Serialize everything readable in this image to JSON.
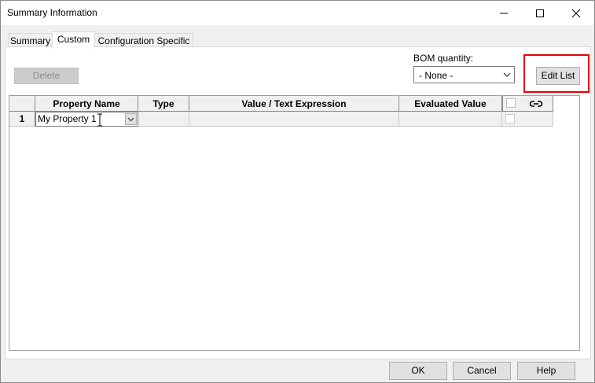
{
  "window": {
    "title": "Summary Information",
    "controls": {
      "minimize_icon": "minimize-icon",
      "maximize_icon": "maximize-icon",
      "close_icon": "close-icon"
    }
  },
  "tabs": [
    "Summary",
    "Custom",
    "Configuration Specific"
  ],
  "toolbar": {
    "delete_label": "Delete",
    "bom_label": "BOM quantity:",
    "bom_value": "- None -",
    "edit_list_label": "Edit List"
  },
  "grid": {
    "headers": [
      "Property Name",
      "Type",
      "Value / Text Expression",
      "Evaluated Value"
    ],
    "link_icon": "link-icon",
    "rows": [
      {
        "num": "1",
        "property_name": "My Property 1",
        "type": "",
        "value": "",
        "evaluated": ""
      }
    ]
  },
  "footer": {
    "ok_label": "OK",
    "cancel_label": "Cancel",
    "help_label": "Help"
  },
  "colors": {
    "highlight": "#e60000",
    "grid_header_bg": "#f0f0f0"
  }
}
